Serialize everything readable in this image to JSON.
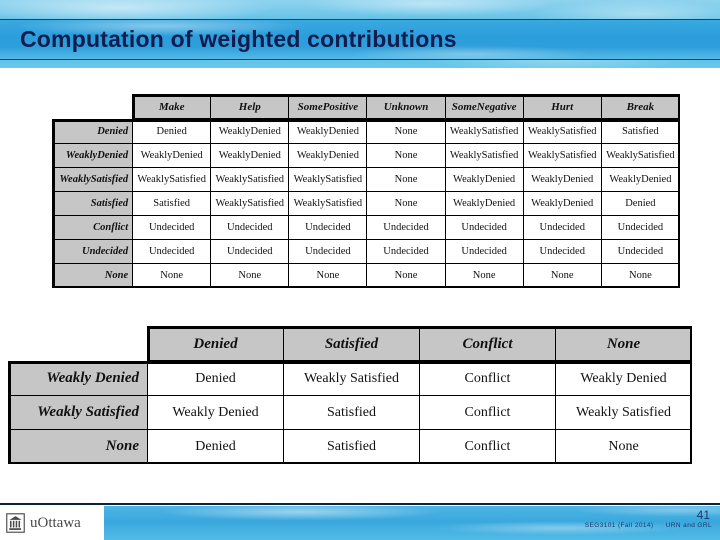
{
  "slide": {
    "title": "Computation of weighted contributions",
    "number": "41",
    "course": "SEG3101 (Fall 2014)",
    "topic": "URN and GRL",
    "logo_text": "uOttawa",
    "colors": {
      "banner_blue": "#2b9ddb",
      "title_navy": "#101d4e",
      "header_gray": "#c6c6c6",
      "grid_black": "#000000"
    }
  },
  "table1": {
    "name": "contribution-propagation-matrix",
    "corner_label": "",
    "columns": [
      "Make",
      "Help",
      "SomePositive",
      "Unknown",
      "SomeNegative",
      "Hurt",
      "Break"
    ],
    "rows": [
      {
        "label": "Denied",
        "cells": [
          "Denied",
          "WeaklyDenied",
          "WeaklyDenied",
          "None",
          "WeaklySatisfied",
          "WeaklySatisfied",
          "Satisfied"
        ]
      },
      {
        "label": "WeaklyDenied",
        "cells": [
          "WeaklyDenied",
          "WeaklyDenied",
          "WeaklyDenied",
          "None",
          "WeaklySatisfied",
          "WeaklySatisfied",
          "WeaklySatisfied"
        ]
      },
      {
        "label": "WeaklySatisfied",
        "cells": [
          "WeaklySatisfied",
          "WeaklySatisfied",
          "WeaklySatisfied",
          "None",
          "WeaklyDenied",
          "WeaklyDenied",
          "WeaklyDenied"
        ]
      },
      {
        "label": "Satisfied",
        "cells": [
          "Satisfied",
          "WeaklySatisfied",
          "WeaklySatisfied",
          "None",
          "WeaklyDenied",
          "WeaklyDenied",
          "Denied"
        ]
      },
      {
        "label": "Conflict",
        "cells": [
          "Undecided",
          "Undecided",
          "Undecided",
          "Undecided",
          "Undecided",
          "Undecided",
          "Undecided"
        ]
      },
      {
        "label": "Undecided",
        "cells": [
          "Undecided",
          "Undecided",
          "Undecided",
          "Undecided",
          "Undecided",
          "Undecided",
          "Undecided"
        ]
      },
      {
        "label": "None",
        "cells": [
          "None",
          "None",
          "None",
          "None",
          "None",
          "None",
          "None"
        ]
      }
    ]
  },
  "table2": {
    "name": "contribution-combination-matrix",
    "corner_label": "",
    "columns": [
      "Denied",
      "Satisfied",
      "Conflict",
      "None"
    ],
    "rows": [
      {
        "label": "Weakly Denied",
        "cells": [
          "Denied",
          "Weakly Satisfied",
          "Conflict",
          "Weakly Denied"
        ]
      },
      {
        "label": "Weakly Satisfied",
        "cells": [
          "Weakly Denied",
          "Satisfied",
          "Conflict",
          "Weakly Satisfied"
        ]
      },
      {
        "label": "None",
        "cells": [
          "Denied",
          "Satisfied",
          "Conflict",
          "None"
        ]
      }
    ]
  }
}
